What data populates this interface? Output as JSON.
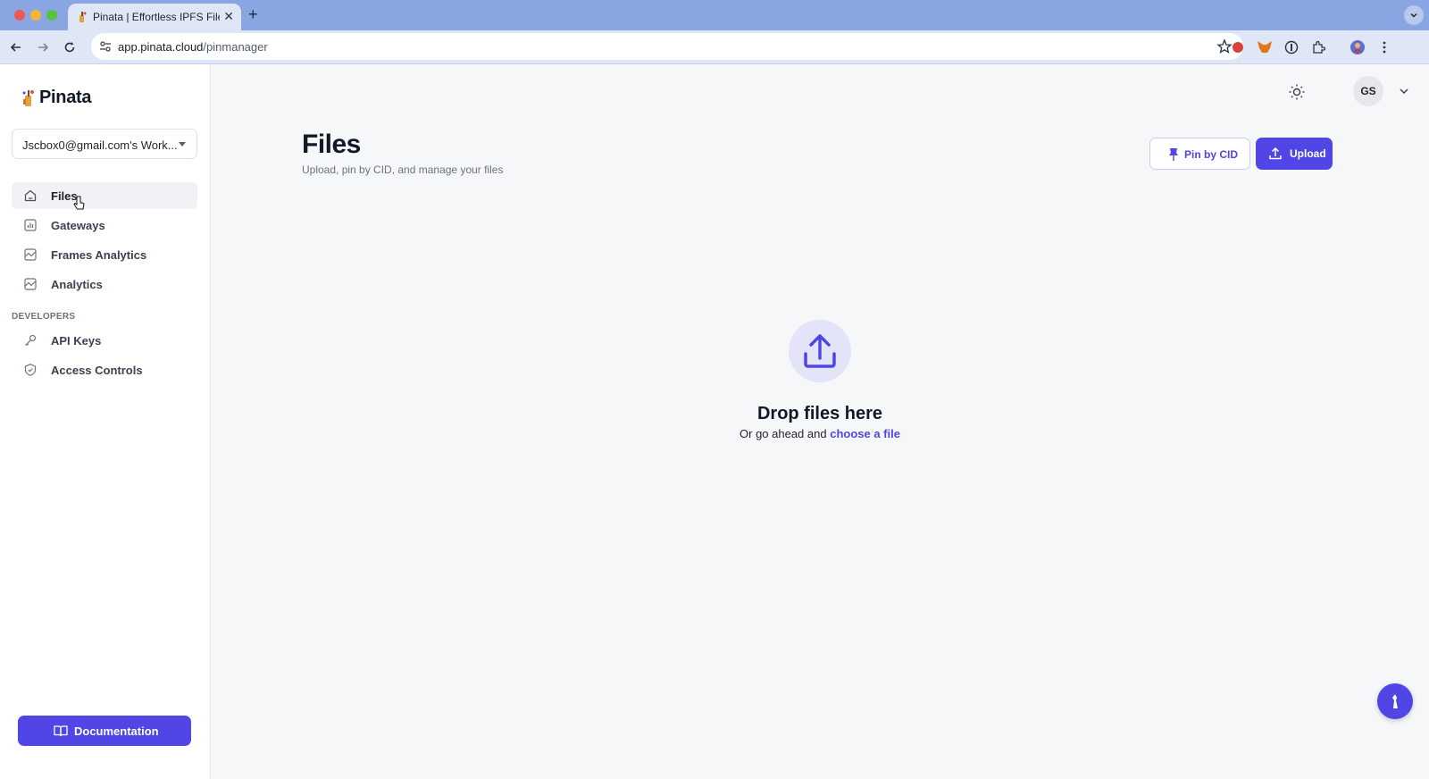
{
  "browser": {
    "tab_title": "Pinata | Effortless IPFS File M",
    "new_tab_label": "+",
    "close_label": "✕",
    "url_host": "app.pinata.cloud",
    "url_path": "/pinmanager"
  },
  "app": {
    "brand": "Pinata",
    "workspace": "Jscbox0@gmail.com's Work...",
    "nav": [
      {
        "label": "Files",
        "icon": "home-icon",
        "active": true
      },
      {
        "label": "Gateways",
        "icon": "bar-chart-icon"
      },
      {
        "label": "Frames Analytics",
        "icon": "line-chart-icon"
      },
      {
        "label": "Analytics",
        "icon": "line-chart-icon"
      }
    ],
    "developers_section": "DEVELOPERS",
    "dev_nav": [
      {
        "label": "API Keys",
        "icon": "key-icon"
      },
      {
        "label": "Access Controls",
        "icon": "shield-icon"
      }
    ],
    "documentation_label": "Documentation"
  },
  "header": {
    "avatar_initials": "GS"
  },
  "page": {
    "title": "Files",
    "subtitle": "Upload, pin by CID, and manage your files",
    "pin_by_cid_label": "Pin by CID",
    "upload_label": "Upload",
    "drop_title": "Drop files here",
    "drop_sub_prefix": "Or go ahead and",
    "drop_link": "choose a file"
  },
  "colors": {
    "accent": "#4f46e5",
    "tab_strip": "#8aa6e2",
    "main_bg": "#f6f7f9"
  }
}
